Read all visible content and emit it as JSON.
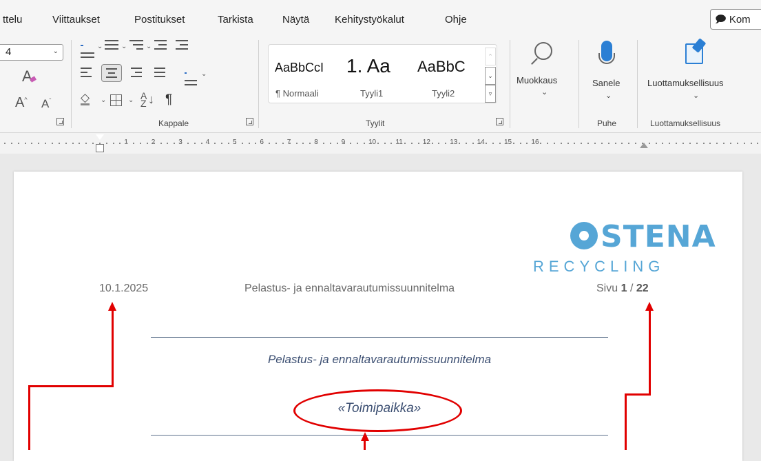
{
  "menu": {
    "tabs": [
      "ttelu",
      "Viittaukset",
      "Postitukset",
      "Tarkista",
      "Näytä",
      "Kehitystyökalut",
      "Ohje"
    ],
    "comments_label": "Kom"
  },
  "ribbon": {
    "font_size_value": "4",
    "groups": {
      "paragraph": "Kappale",
      "styles": "Tyylit",
      "speech": "Puhe",
      "sensitivity": "Luottamuksellisuus"
    },
    "styles": [
      {
        "sample": "AaBbCcI",
        "name": "¶ Normaali"
      },
      {
        "sample": "1. Aa",
        "name": "Tyyli1"
      },
      {
        "sample": "AaBbC",
        "name": "Tyyli2"
      }
    ],
    "editing_label": "Muokkaus",
    "dictate_label": "Sanele",
    "sensitivity_label": "Luottamuksellisuus"
  },
  "ruler": {
    "numbers": [
      "1",
      "2",
      "3",
      "4",
      "5",
      "6",
      "7",
      "8",
      "9",
      "10",
      "11",
      "12",
      "13",
      "14",
      "15",
      "16"
    ]
  },
  "document": {
    "header_date": "10.1.2025",
    "header_title": "Pelastus- ja ennaltavarautumissuunnitelma",
    "page_label": "Sivu",
    "page_current": "1",
    "page_separator": "/",
    "page_total": "22",
    "logo_brand": "STENA",
    "logo_sub": "RECYCLING",
    "body_title": "Pelastus- ja ennaltavarautumissuunnitelma",
    "body_field": "«Toimipaikka»"
  },
  "colors": {
    "annotation": "#e10000",
    "logo": "#56a6d6",
    "title_text": "#3c4f72"
  }
}
